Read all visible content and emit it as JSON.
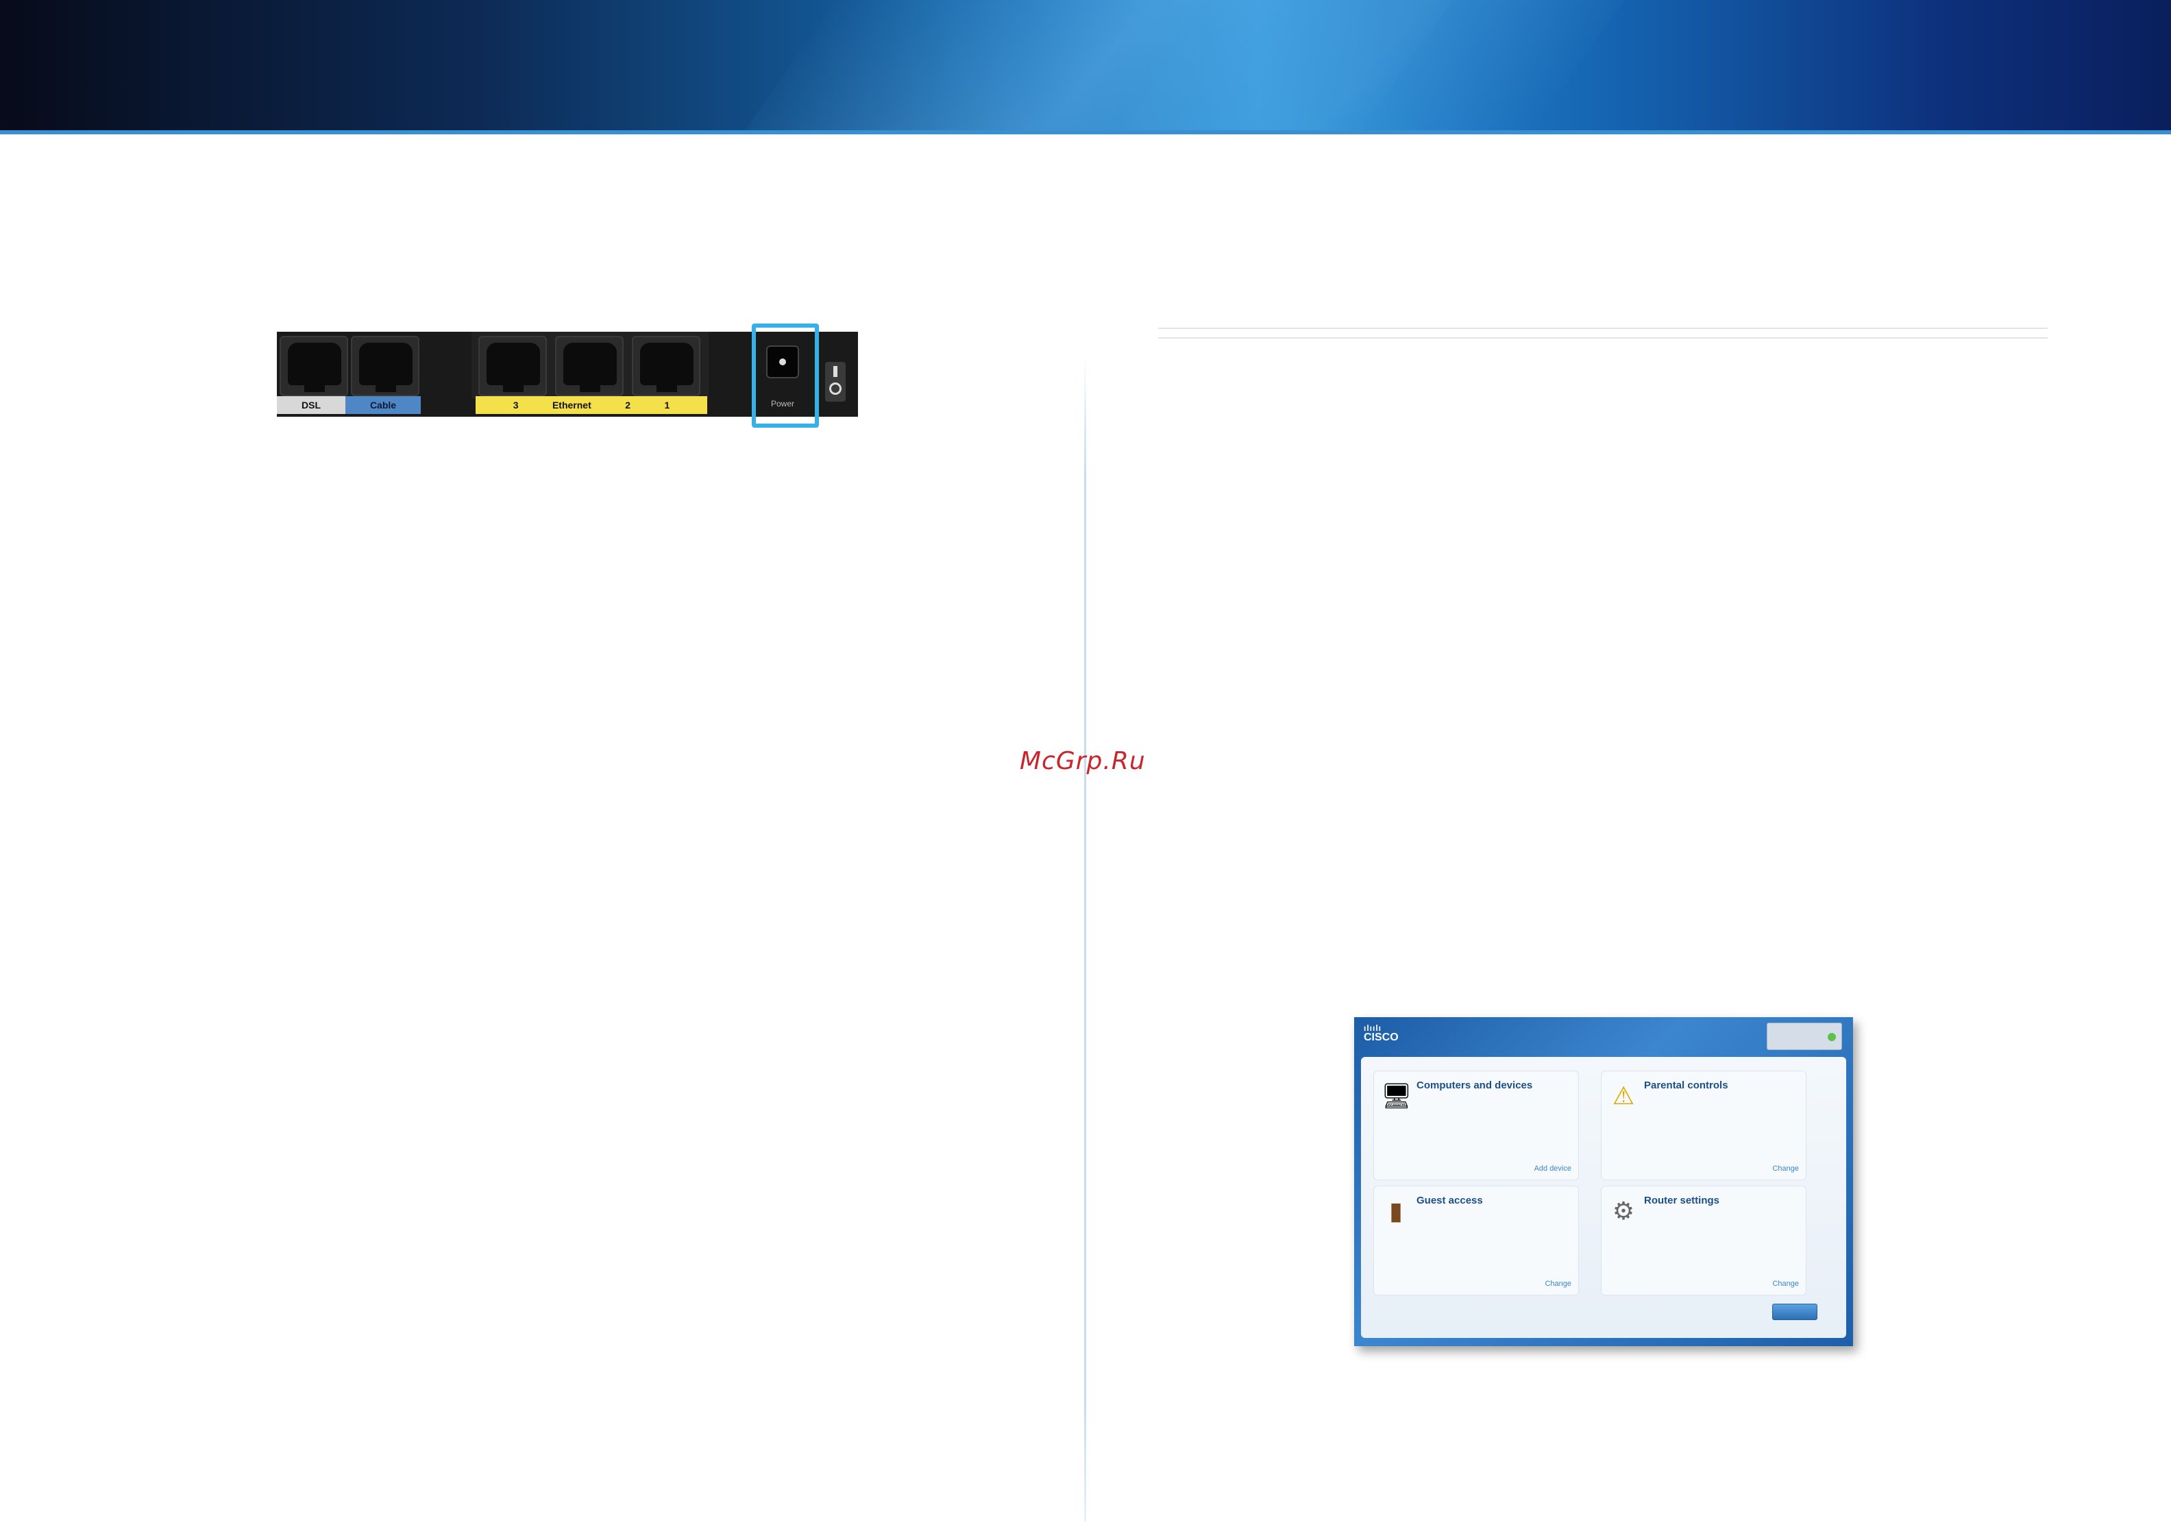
{
  "router_panel": {
    "labels": {
      "dsl": "DSL",
      "cable": "Cable",
      "eth3": "3",
      "ethernet": "Ethernet",
      "eth2": "2",
      "eth1": "1",
      "power": "Power"
    }
  },
  "watermark": "McGrp.Ru",
  "dashboard": {
    "logo_text": "CISCO",
    "tiles": [
      {
        "title": "Computers and devices",
        "link": "Add device"
      },
      {
        "title": "Parental controls",
        "link": "Change"
      },
      {
        "title": "Guest access",
        "link": "Change"
      },
      {
        "title": "Router settings",
        "link": "Change"
      }
    ]
  },
  "colors": {
    "highlight": "#35b1ea",
    "watermark": "#c8262c",
    "cable_label": "#4f86c6",
    "ethernet_label": "#f4e04a"
  },
  "icons": {
    "tile1": "computer-icon",
    "tile2": "warning-icon",
    "tile3": "guest-house-icon",
    "tile4": "gears-icon"
  }
}
